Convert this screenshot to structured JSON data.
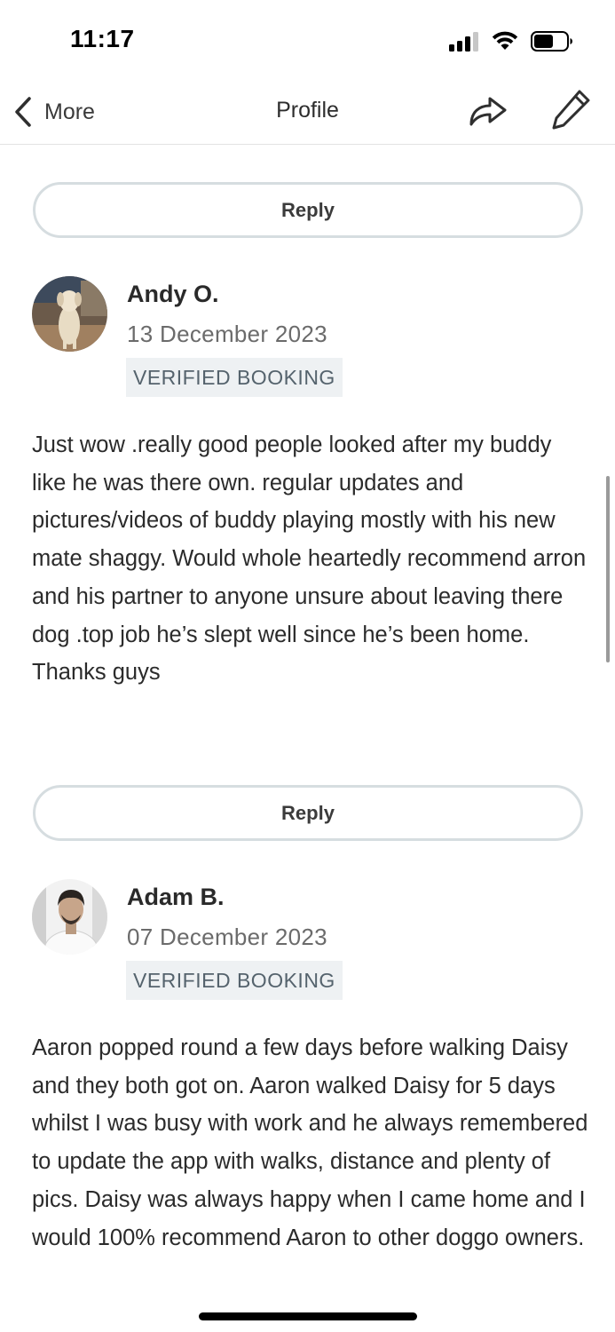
{
  "status_bar": {
    "time": "11:17",
    "signal_icon": "cellular-signal-icon",
    "wifi_icon": "wifi-icon",
    "battery_icon": "battery-icon",
    "battery_level": 0.6
  },
  "nav": {
    "back_label": "More",
    "title": "Profile",
    "share_icon": "share-arrow-icon",
    "edit_icon": "pencil-icon"
  },
  "reply_label": "Reply",
  "reviews": [
    {
      "author": "Andy O.",
      "date": "13 December 2023",
      "badge": "VERIFIED BOOKING",
      "text": "Just wow .really good people looked after my buddy like he was there own. regular updates and pictures/videos of buddy playing mostly with his new mate shaggy. Would whole heartedly recommend arron and his partner to anyone unsure about leaving there dog .top job he’s slept well since he’s been home. Thanks guys",
      "reply_label": "Reply"
    },
    {
      "author": "Adam B.",
      "date": "07 December 2023",
      "badge": "VERIFIED BOOKING",
      "text": "Aaron popped round a few days before walking Daisy and they both got on.  Aaron walked Daisy for 5 days whilst I was busy with work and he always remembered to update the app with walks, distance and plenty of pics.  Daisy was always happy when I came home and I would 100% recommend Aaron to other doggo owners."
    }
  ]
}
